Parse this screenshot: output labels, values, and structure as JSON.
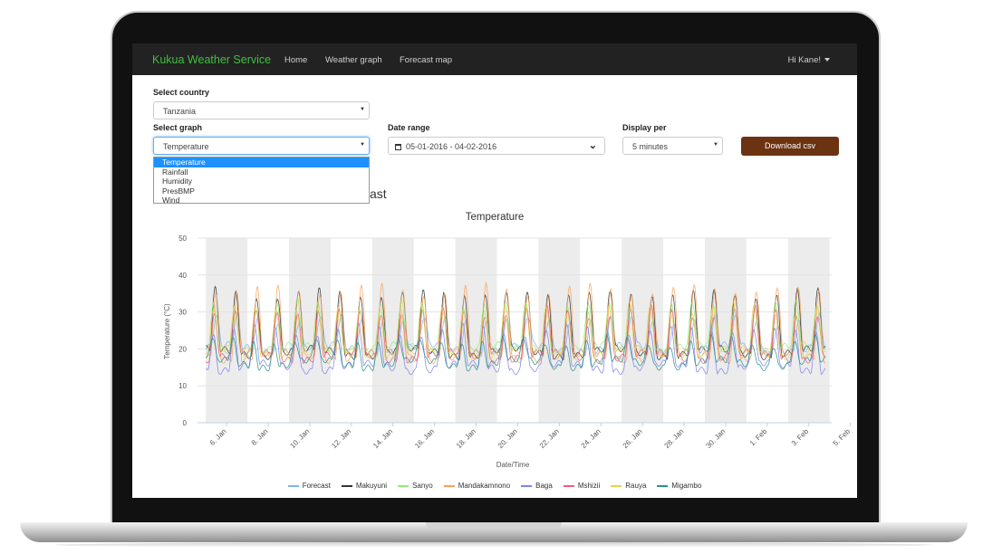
{
  "navbar": {
    "brand": "Kukua Weather Service",
    "links": [
      "Home",
      "Weather graph",
      "Forecast map"
    ],
    "user": "Hi Kane!"
  },
  "form": {
    "country_label": "Select country",
    "country_value": "Tanzania",
    "graph_label": "Select graph",
    "graph_value": "Temperature",
    "graph_options": [
      "Temperature",
      "Rainfall",
      "Humidity",
      "PresBMP",
      "Wind"
    ],
    "date_label": "Date range",
    "date_value": "05-01-2016 - 04-02-2016",
    "display_label": "Display per",
    "display_value": "5 minutes",
    "download_label": "Download csv"
  },
  "heading_tail": "ast",
  "colors": {
    "navbar": "#222222",
    "brand": "#3fbf3f",
    "download_button": "#6b3312",
    "dropdown_selected": "#1e90ff"
  },
  "chart_data": {
    "type": "line",
    "title": "Temperature",
    "xlabel": "Date/Time",
    "ylabel": "Temperature (°C)",
    "ylim": [
      0,
      50
    ],
    "y_ticks": [
      "0",
      "10",
      "20",
      "30",
      "40",
      "50"
    ],
    "x_tick_labels": [
      "6. Jan",
      "8. Jan",
      "10. Jan",
      "12. Jan",
      "14. Jan",
      "16. Jan",
      "18. Jan",
      "20. Jan",
      "22. Jan",
      "24. Jan",
      "26. Jan",
      "28. Jan",
      "30. Jan",
      "1. Feb",
      "3. Feb",
      "5. Feb"
    ],
    "x_range_days": [
      4.6,
      35.1
    ],
    "grid": true,
    "legend_position": "bottom",
    "series": [
      {
        "name": "Forecast",
        "color": "#7cb5ec",
        "min": 20,
        "max": 28,
        "phase": 0.0
      },
      {
        "name": "Makuyuni",
        "color": "#333333",
        "min": 19,
        "max": 35,
        "phase": 0.05
      },
      {
        "name": "Sanyo",
        "color": "#90ed7d",
        "min": 20,
        "max": 32,
        "phase": 0.1
      },
      {
        "name": "Mandakamnono",
        "color": "#f7a35c",
        "min": 18,
        "max": 36,
        "phase": 0.02
      },
      {
        "name": "Baga",
        "color": "#8085e9",
        "min": 15,
        "max": 25,
        "phase": 0.15
      },
      {
        "name": "Mshizii",
        "color": "#f15c80",
        "min": 18,
        "max": 30,
        "phase": 0.08
      },
      {
        "name": "Rauya",
        "color": "#e4d354",
        "min": 19,
        "max": 31,
        "phase": 0.12
      },
      {
        "name": "Migambo",
        "color": "#2b908f",
        "min": 16,
        "max": 22,
        "phase": 0.2
      }
    ]
  }
}
